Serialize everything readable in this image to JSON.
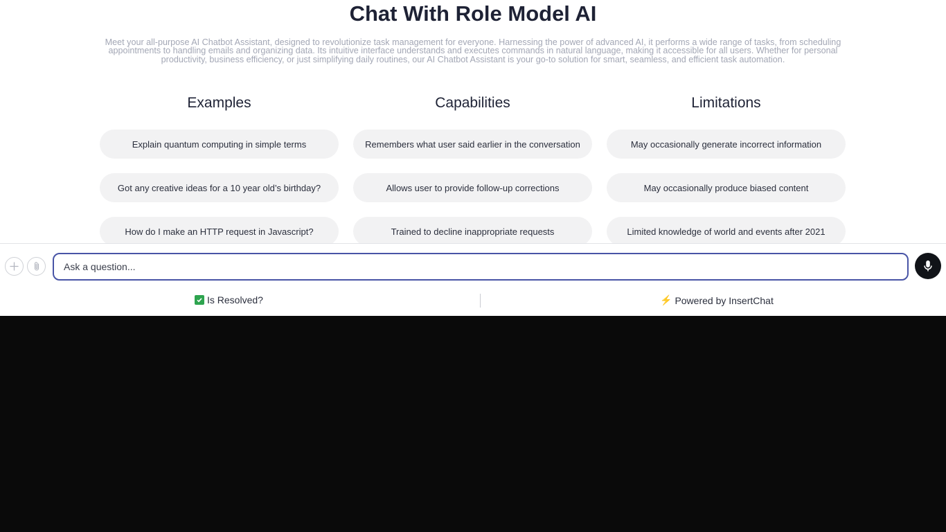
{
  "header": {
    "title": "Chat With Role Model AI",
    "description": "Meet your all-purpose AI Chatbot Assistant, designed to revolutionize task management for everyone. Harnessing the power of advanced AI, it performs a wide range of tasks, from scheduling appointments to handling emails and organizing data. Its intuitive interface understands and executes commands in natural language, making it accessible for all users. Whether for personal productivity, business efficiency, or just simplifying daily routines, our AI Chatbot Assistant is your go-to solution for smart, seamless, and efficient task automation."
  },
  "columns": [
    {
      "heading": "Examples",
      "items": [
        "Explain quantum computing in simple terms",
        "Got any creative ideas for a 10 year old’s birthday?",
        "How do I make an HTTP request in Javascript?"
      ]
    },
    {
      "heading": "Capabilities",
      "items": [
        "Remembers what user said earlier in the conversation",
        "Allows user to provide follow-up corrections",
        "Trained to decline inappropriate requests"
      ]
    },
    {
      "heading": "Limitations",
      "items": [
        "May occasionally generate incorrect information",
        "May occasionally produce biased content",
        "Limited knowledge of world and events after 2021"
      ]
    }
  ],
  "composer": {
    "placeholder": "Ask a question...",
    "value": "",
    "left_icons": [
      "plus-icon",
      "paperclip-icon"
    ],
    "right_icon": "microphone-icon"
  },
  "footer": {
    "resolved_label": "Is Resolved?",
    "powered_label": "Powered by InsertChat"
  },
  "colors": {
    "accent": "#4854a6",
    "pill_bg": "#f2f2f3",
    "check": "#2ea44f"
  }
}
